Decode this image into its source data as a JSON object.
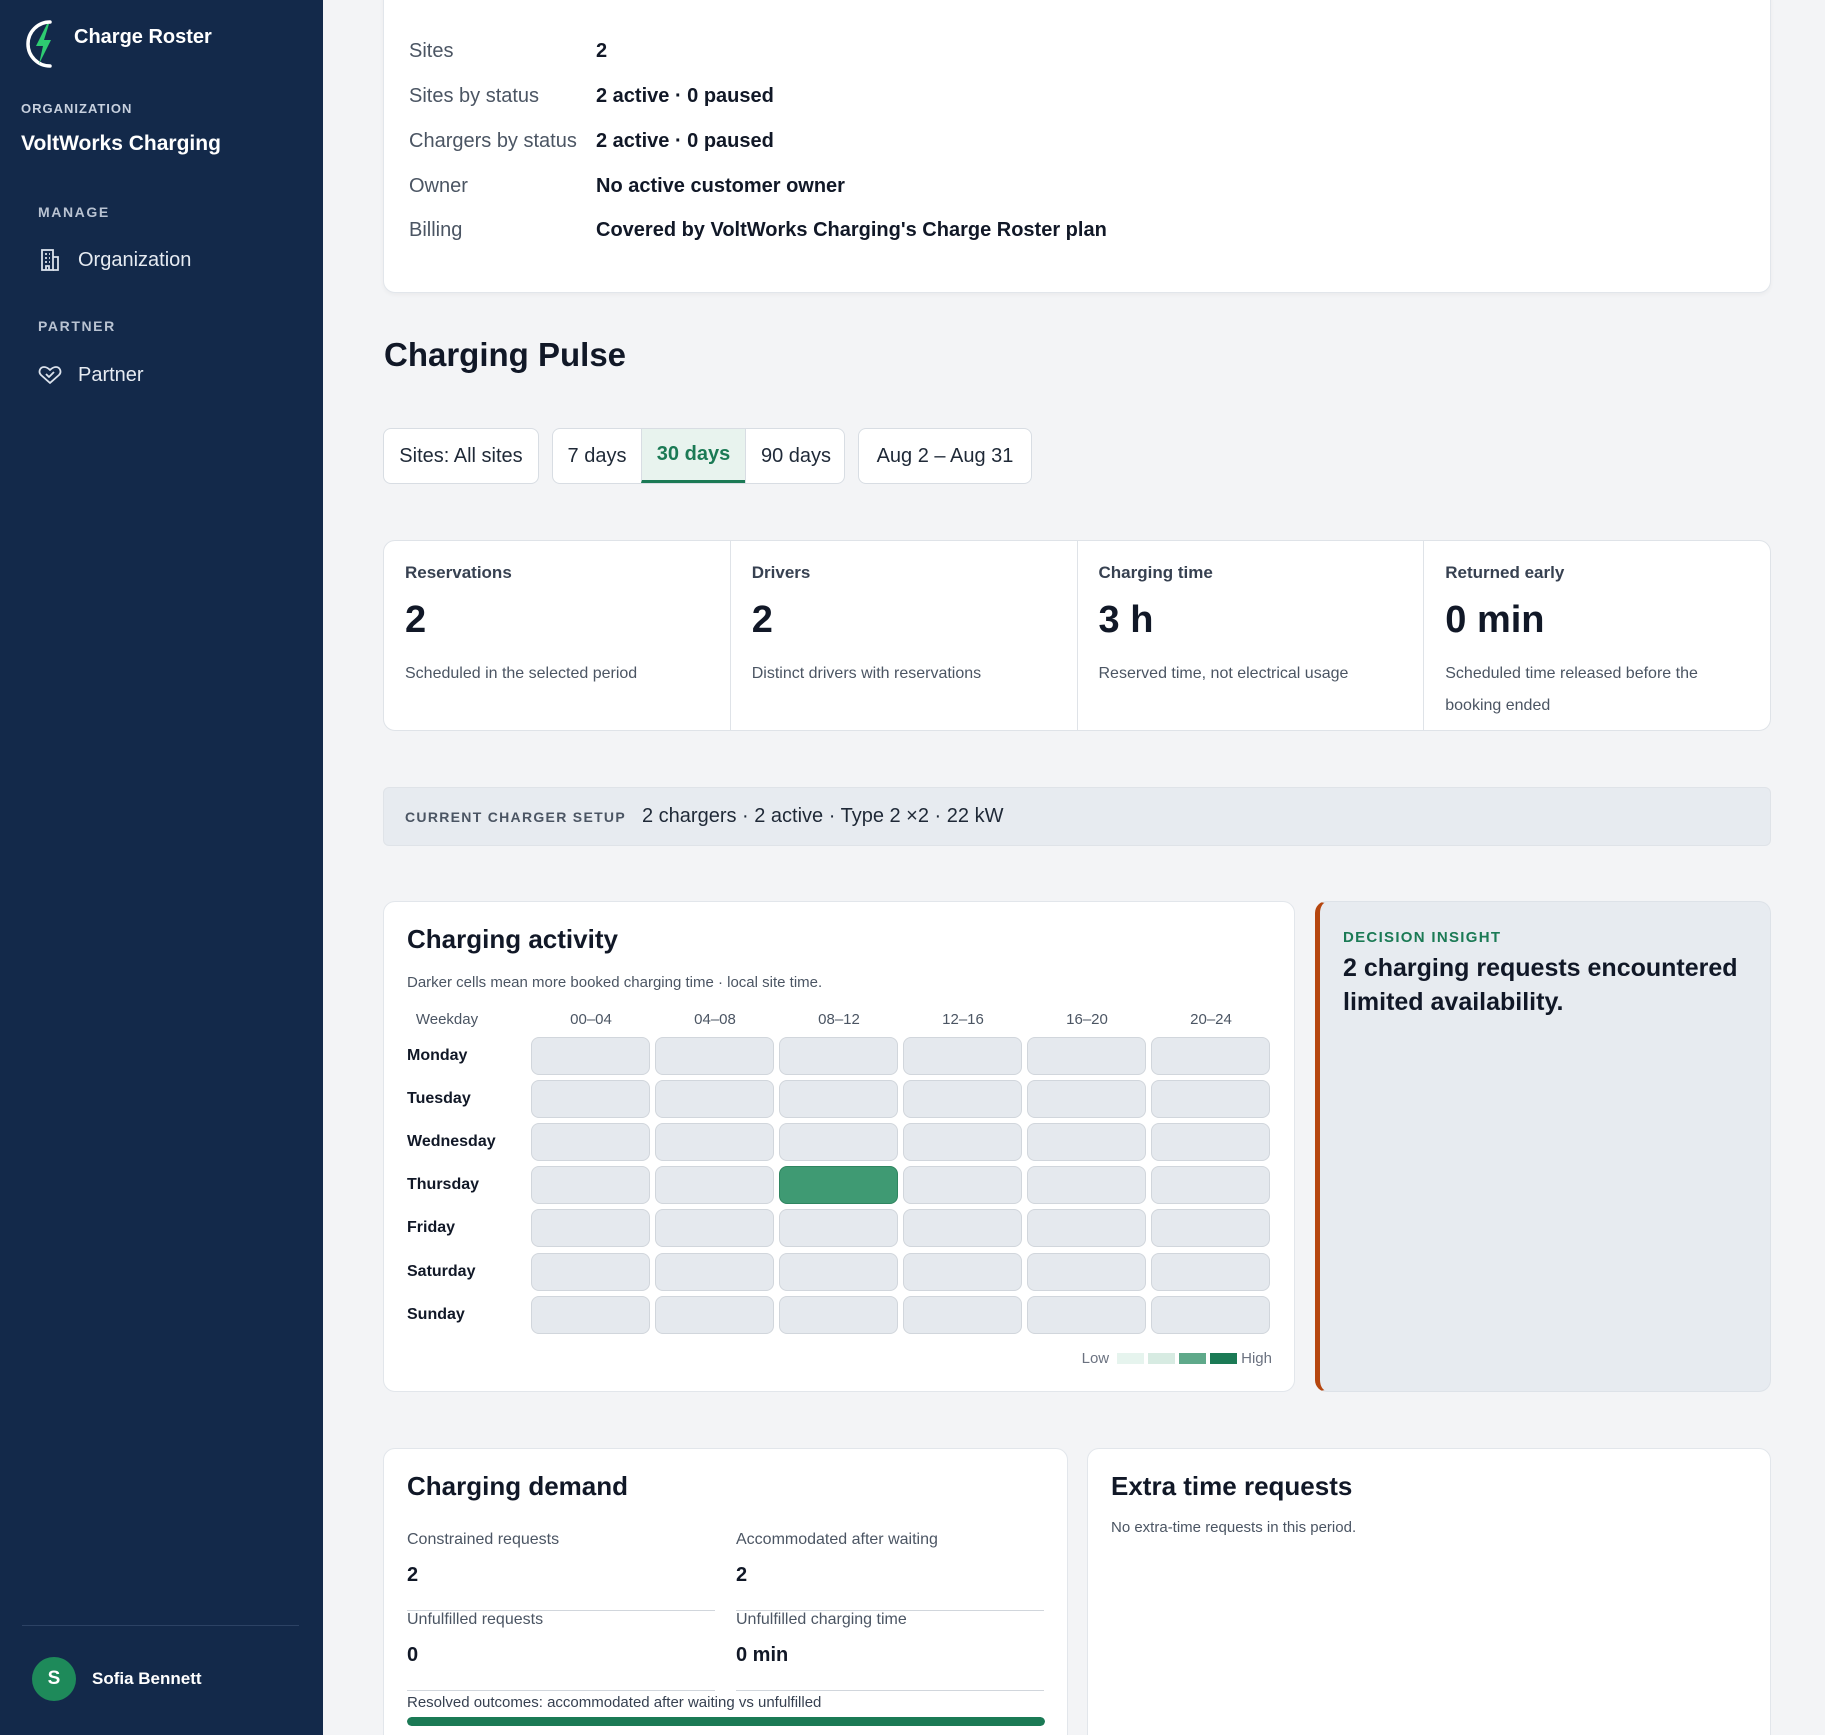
{
  "app": {
    "name": "Charge Roster",
    "brand_color": "#1b7a55",
    "logo_icon": "lightning-bolt-icon"
  },
  "sidebar": {
    "org_caption": "ORGANIZATION",
    "org_name": "VoltWorks Charging",
    "sections": [
      {
        "caption": "MANAGE",
        "items": [
          {
            "label": "Organization",
            "icon": "building-icon"
          }
        ]
      },
      {
        "caption": "PARTNER",
        "items": [
          {
            "label": "Partner",
            "icon": "handshake-icon"
          }
        ]
      }
    ],
    "user": {
      "initial": "S",
      "name": "Sofia Bennett"
    }
  },
  "summary": {
    "rows": [
      {
        "label": "Sites",
        "value": "2"
      },
      {
        "label": "Sites by status",
        "value": "2 active · 0 paused"
      },
      {
        "label": "Chargers by status",
        "value": "2 active · 0 paused"
      },
      {
        "label": "Owner",
        "value": "No active customer owner"
      },
      {
        "label": "Billing",
        "value": "Covered by VoltWorks Charging's Charge Roster plan"
      }
    ]
  },
  "page": {
    "title": "Charging Pulse"
  },
  "filters": {
    "sites": "Sites: All sites",
    "ranges": [
      "7 days",
      "30 days",
      "90 days"
    ],
    "active_range": "30 days",
    "date_range": "Aug 2 – Aug 31"
  },
  "metrics": [
    {
      "label": "Reservations",
      "value": "2",
      "note": "Scheduled in the selected period"
    },
    {
      "label": "Drivers",
      "value": "2",
      "note": "Distinct drivers with reservations"
    },
    {
      "label": "Charging time",
      "value": "3 h",
      "note": "Reserved time, not electrical usage"
    },
    {
      "label": "Returned early",
      "value": "0 min",
      "note": "Scheduled time released before the booking ended"
    }
  ],
  "charger_setup": {
    "caption": "CURRENT CHARGER SETUP",
    "value": "2 chargers · 2 active · Type 2 ×2 · 22 kW"
  },
  "activity": {
    "title": "Charging activity",
    "subtitle": "Darker cells mean more booked charging time · local site time.",
    "weekday_header": "Weekday",
    "time_slots": [
      "00–04",
      "04–08",
      "08–12",
      "12–16",
      "16–20",
      "20–24"
    ],
    "days": [
      "Monday",
      "Tuesday",
      "Wednesday",
      "Thursday",
      "Friday",
      "Saturday",
      "Sunday"
    ],
    "levels": [
      [
        0,
        0,
        0,
        0,
        0,
        0
      ],
      [
        0,
        0,
        0,
        0,
        0,
        0
      ],
      [
        0,
        0,
        0,
        0,
        0,
        0
      ],
      [
        0,
        0,
        1,
        0,
        0,
        0
      ],
      [
        0,
        0,
        0,
        0,
        0,
        0
      ],
      [
        0,
        0,
        0,
        0,
        0,
        0
      ],
      [
        0,
        0,
        0,
        0,
        0,
        0
      ]
    ],
    "legend": {
      "low": "Low",
      "high": "High",
      "colors": [
        "#e6f4ee",
        "#d7ebe2",
        "#5fa98a",
        "#1b7a55"
      ]
    }
  },
  "insight": {
    "caption": "DECISION INSIGHT",
    "text": "2 charging requests encountered limited availability."
  },
  "demand": {
    "title": "Charging demand",
    "items": [
      {
        "label": "Constrained requests",
        "value": "2"
      },
      {
        "label": "Accommodated after waiting",
        "value": "2"
      },
      {
        "label": "Unfulfilled requests",
        "value": "0"
      },
      {
        "label": "Unfulfilled charging time",
        "value": "0 min"
      }
    ],
    "bar_caption": "Resolved outcomes: accommodated after waiting vs unfulfilled",
    "bar_fraction": 1.0
  },
  "extra_time": {
    "title": "Extra time requests",
    "empty_text": "No extra-time requests in this period."
  }
}
